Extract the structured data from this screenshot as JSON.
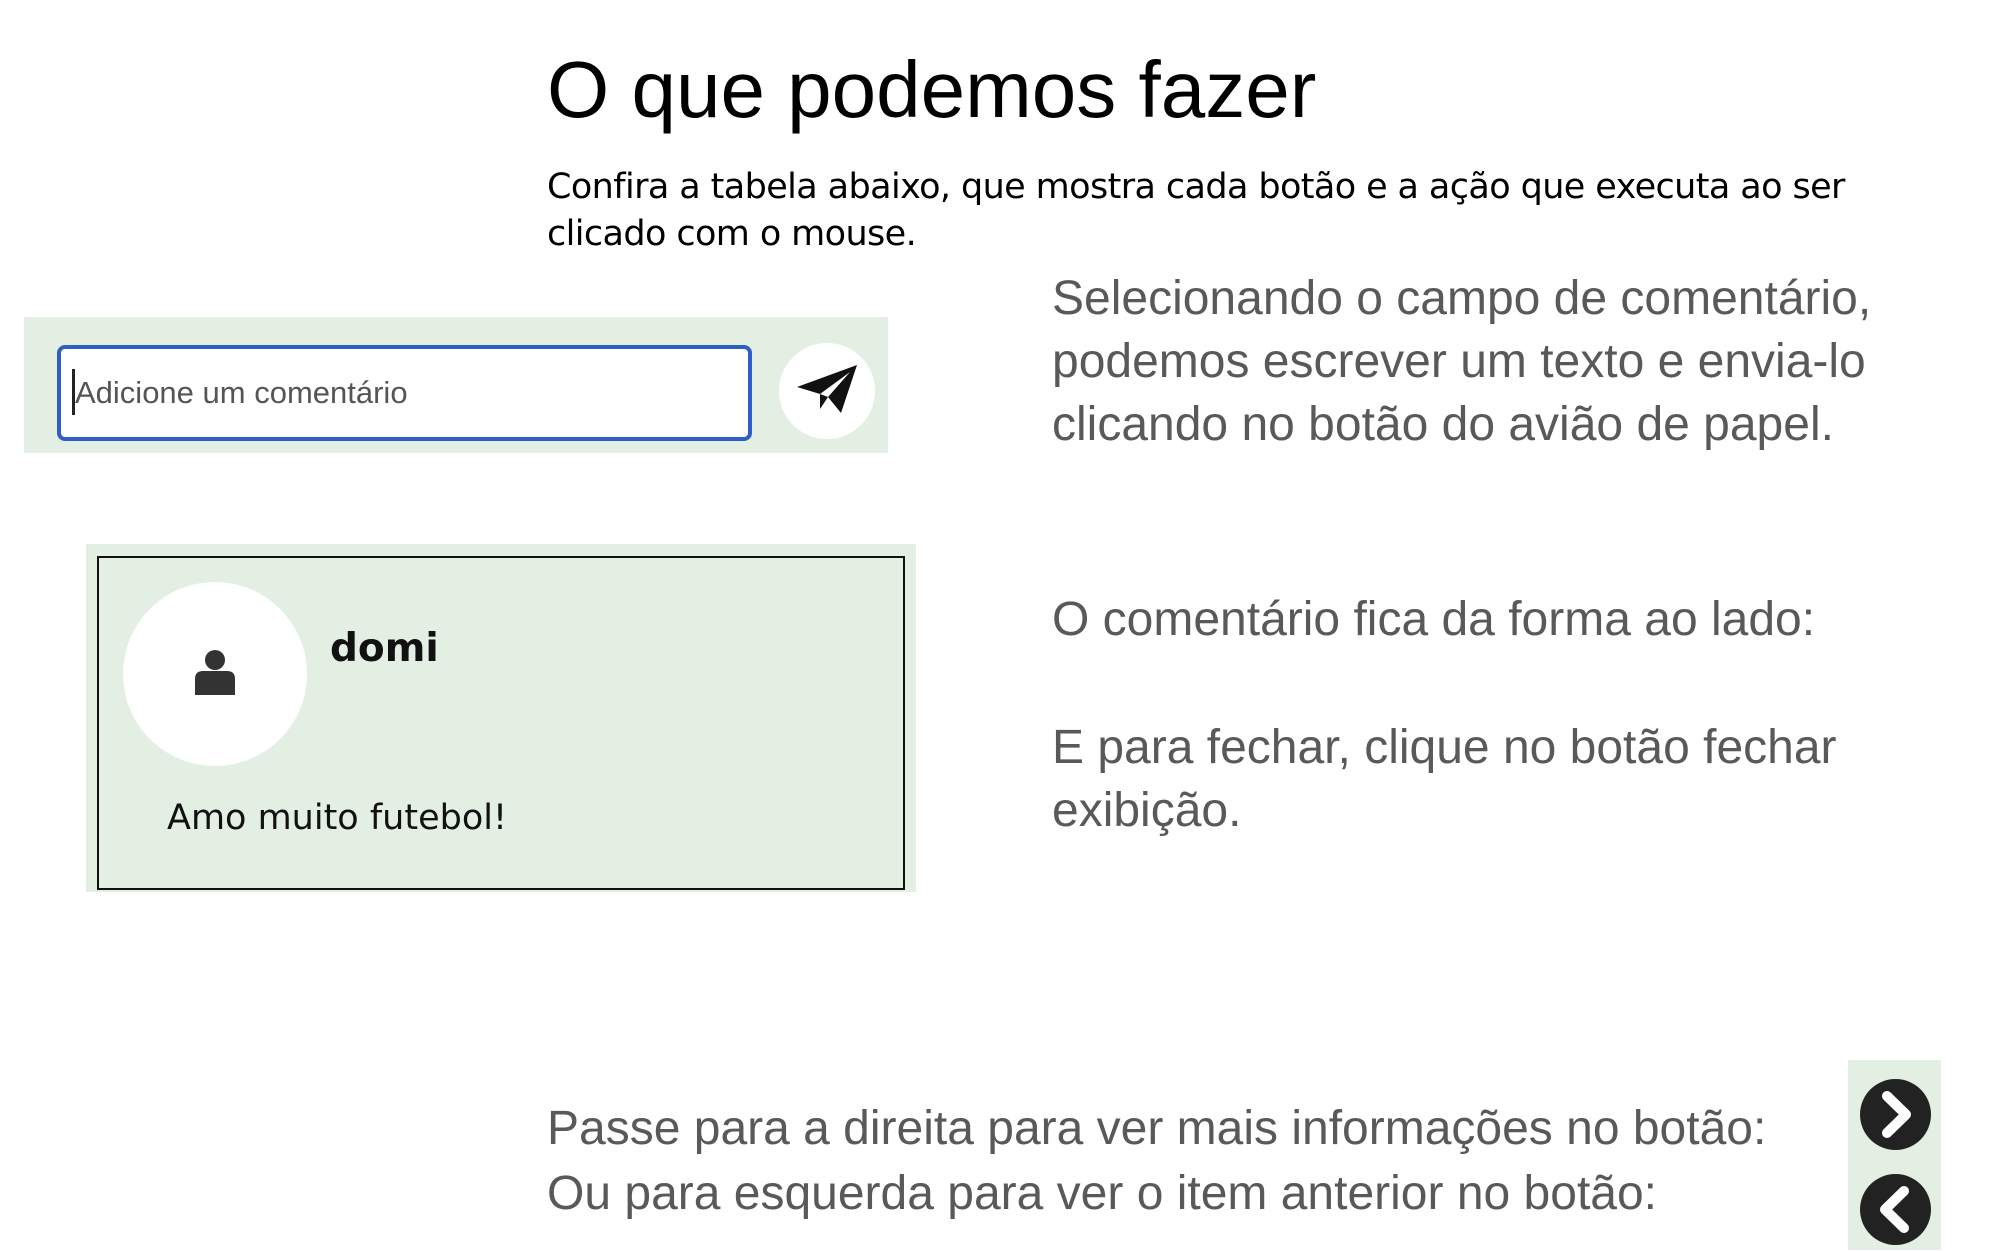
{
  "page": {
    "title": "O que podemos fazer",
    "intro_lines": [
      "Confira a tabela abaixo, que mostra cada botão e a ação que executa ao ser",
      "clicado com o mouse."
    ]
  },
  "comment_form": {
    "placeholder": "Adicione um comentário",
    "send_icon": "paper-plane-icon"
  },
  "send_description_lines": [
    "Selecionando o campo de comentário,",
    "podemos escrever um texto e envia-lo",
    "clicando no botão do avião de papel."
  ],
  "comment_card": {
    "avatar_icon": "user-icon",
    "username": "domi",
    "text": "Amo muito futebol!"
  },
  "comment_description": "O comentário fica da forma ao lado:",
  "close_description_lines": [
    "E para fechar, clique no botão fechar",
    "exibição."
  ],
  "navigation": {
    "next_text": "Passe para a direita para ver mais informações no botão:",
    "prev_text": "Ou para esquerda para ver o item anterior no botão:",
    "next_icon": "chevron-right-icon",
    "prev_icon": "chevron-left-icon"
  },
  "colors": {
    "panel_bg": "#e4efe3",
    "input_border": "#2f5fc4",
    "description_text": "#595959"
  }
}
